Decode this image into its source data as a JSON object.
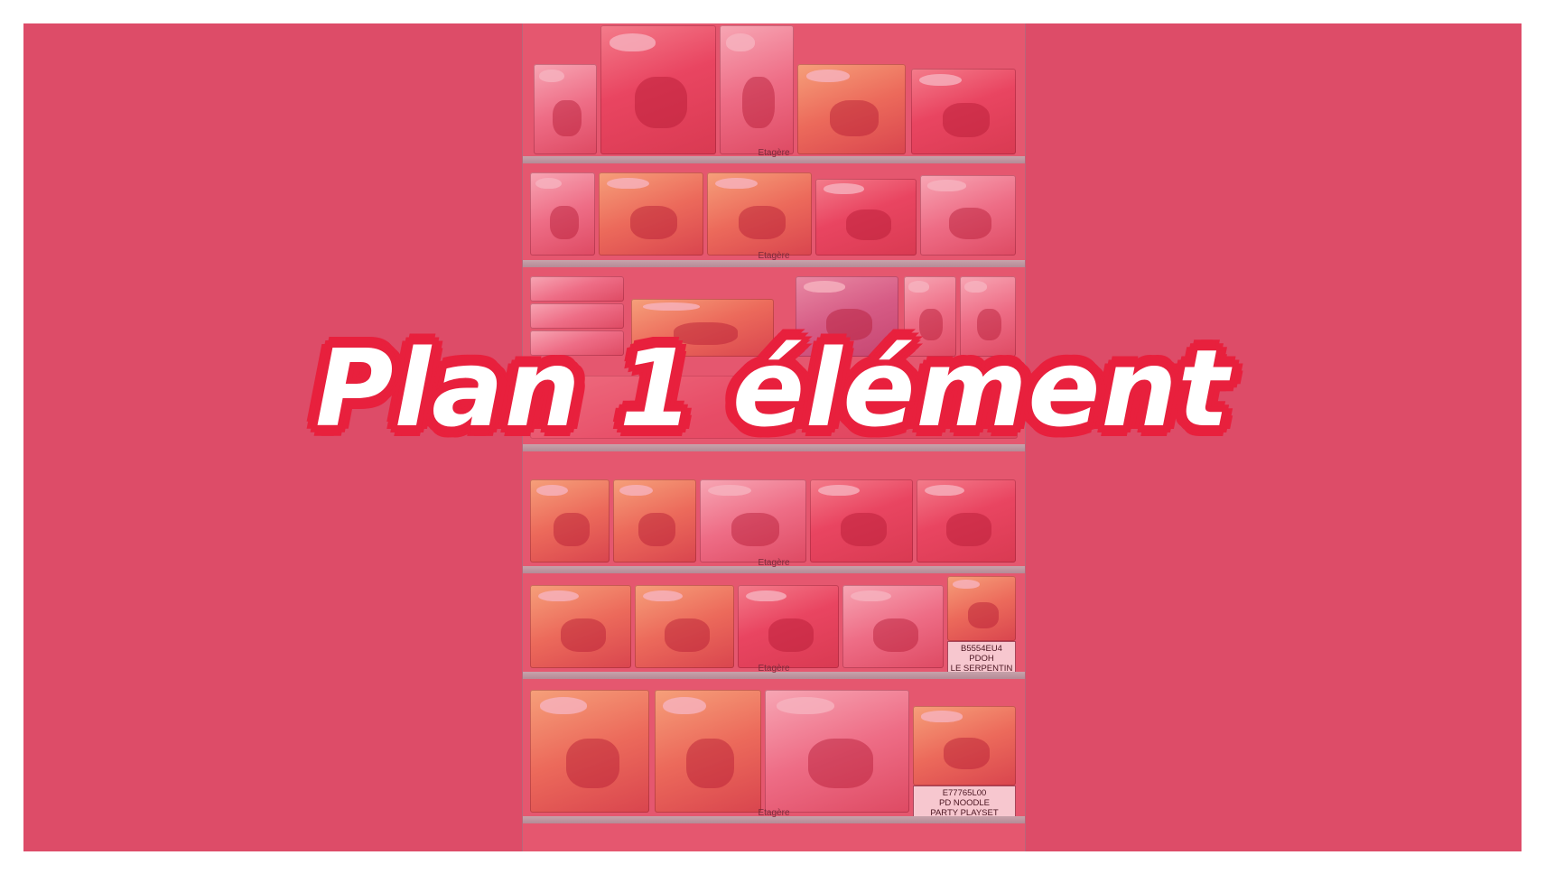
{
  "title": "Plan 1 élément",
  "shelf_label": "Etagère",
  "sku_tags": [
    {
      "code": "B5554EU4",
      "line1": "PDOH",
      "line2": "LE SERPENTIN"
    },
    {
      "code": "E77765L00",
      "line1": "PD NOODLE",
      "line2": "PARTY PLAYSET"
    }
  ],
  "colors": {
    "background": "#ffffff",
    "overlay": "#dd4c68",
    "title_fill": "#ffffff",
    "title_outline": "#e8203d"
  }
}
